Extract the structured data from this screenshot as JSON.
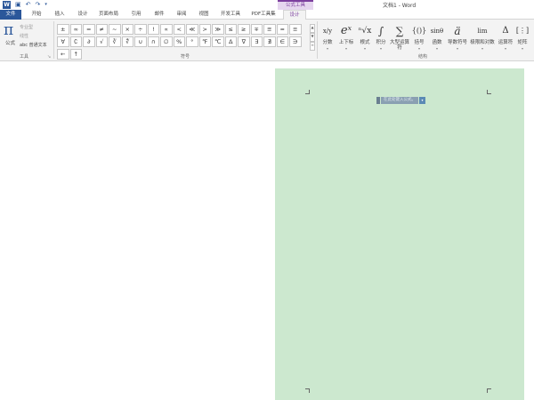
{
  "window": {
    "title": "文档1 - Word",
    "context_group": "公式工具"
  },
  "tabs": [
    {
      "label": "文件"
    },
    {
      "label": "开始"
    },
    {
      "label": "插入"
    },
    {
      "label": "设计"
    },
    {
      "label": "页面布局"
    },
    {
      "label": "引用"
    },
    {
      "label": "邮件"
    },
    {
      "label": "审阅"
    },
    {
      "label": "视图"
    },
    {
      "label": "开发工具"
    },
    {
      "label": "PDF工具集"
    },
    {
      "label": "设计"
    }
  ],
  "tools": {
    "equation_label": "公式",
    "professional": "专业型",
    "linear": "线性",
    "normal_text": "abc 普通文本",
    "group_label": "工具"
  },
  "symbols": {
    "group_label": "符号",
    "items": [
      "±",
      "∞",
      "=",
      "≠",
      "~",
      "×",
      "÷",
      "!",
      "∝",
      "<",
      "≪",
      ">",
      "≫",
      "≤",
      "≥",
      "∓",
      "≅",
      "≈",
      "≡",
      "∀",
      "∁",
      "∂",
      "√",
      "∛",
      "∜",
      "∪",
      "∩",
      "∅",
      "%",
      "°",
      "℉",
      "℃",
      "∆",
      "∇",
      "∃",
      "∄",
      "∈",
      "∋",
      "←",
      "↑"
    ]
  },
  "structures": {
    "group_label": "结构",
    "items": [
      {
        "label": "分数",
        "glyph": "x/y"
      },
      {
        "label": "上下标",
        "glyph": "eˣ"
      },
      {
        "label": "根式",
        "glyph": "ⁿ√x"
      },
      {
        "label": "积分",
        "glyph": "∫"
      },
      {
        "label": "大型运算符",
        "glyph": "∑"
      },
      {
        "label": "括号",
        "glyph": "{()}"
      },
      {
        "label": "函数",
        "glyph": "sinθ"
      },
      {
        "label": "导数符号",
        "glyph": "ä"
      },
      {
        "label": "极限和对数",
        "glyph": "lim"
      },
      {
        "label": "运算符",
        "glyph": "Δ"
      },
      {
        "label": "矩阵",
        "glyph": "[⋮]"
      }
    ]
  },
  "document": {
    "equation_placeholder": "在此处键入公式。"
  }
}
